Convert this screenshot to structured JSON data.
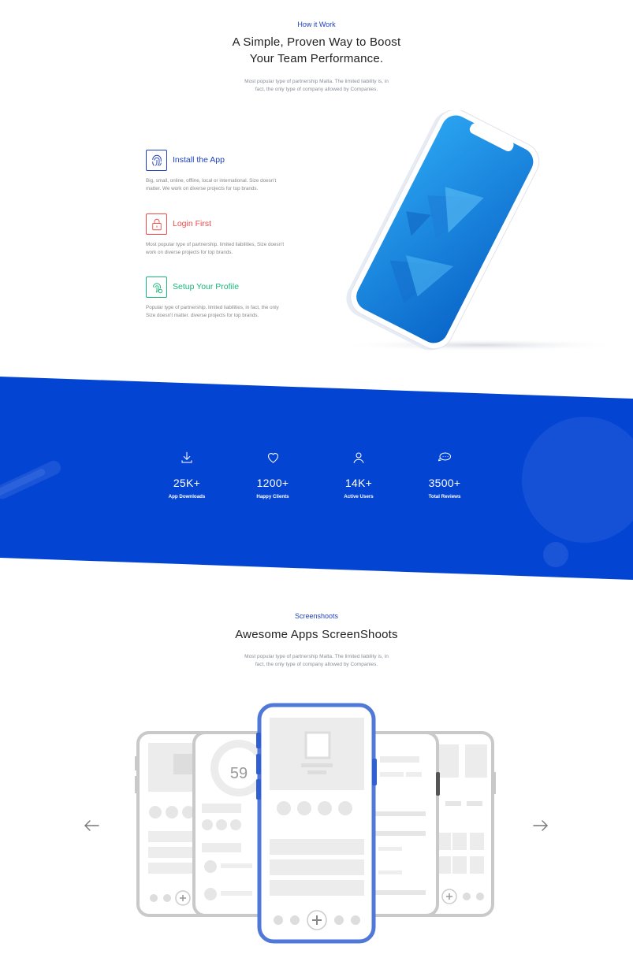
{
  "how": {
    "eyebrow": "How it Work",
    "title_line1": "A Simple, Proven Way to Boost",
    "title_line2": "Your Team Performance.",
    "desc_line1": "Most popular type of partnership Malta. The limited liability is, in",
    "desc_line2": "fact, the only type of company allowed by Companies."
  },
  "steps": [
    {
      "icon": "fingerprint-icon",
      "title": "Install the App",
      "desc_line1": "Big, small, online, offline, local or international. Size doesn't",
      "desc_line2": "matter. We work on diverse projects for top brands.",
      "color": "#1d3fbf"
    },
    {
      "icon": "lock-icon",
      "title": "Login First",
      "desc_line1": "Most popular type of partnership. limited liabilities, Size doesn't",
      "desc_line2": "work on diverse projects for top brands.",
      "color": "#f04a4a"
    },
    {
      "icon": "profile-fingerprint-icon",
      "title": "Setup Your Profile",
      "desc_line1": "Popular type of partnership. limited liabilities, in fact, the only",
      "desc_line2": "Size doesn't matter. diverse projects for top brands.",
      "color": "#18b779"
    }
  ],
  "stats": [
    {
      "icon": "download-icon",
      "number": "25K+",
      "label": "App Downloads"
    },
    {
      "icon": "heart-icon",
      "number": "1200+",
      "label": "Happy Clients"
    },
    {
      "icon": "user-icon",
      "number": "14K+",
      "label": "Active Users"
    },
    {
      "icon": "review-chat-icon",
      "number": "3500+",
      "label": "Total Reviews"
    }
  ],
  "screens": {
    "eyebrow": "Screenshoots",
    "title": "Awesome Apps ScreenShoots",
    "desc_line1": "Most popular type of partnership Malta. The limited liability is, in",
    "desc_line2": "fact, the only type of company allowed by Companies.",
    "gauge_value": "59"
  },
  "colors": {
    "brand_blue": "#0444d3",
    "accent_blue": "#1d3fbf",
    "red": "#f04a4a",
    "green": "#18b779"
  }
}
